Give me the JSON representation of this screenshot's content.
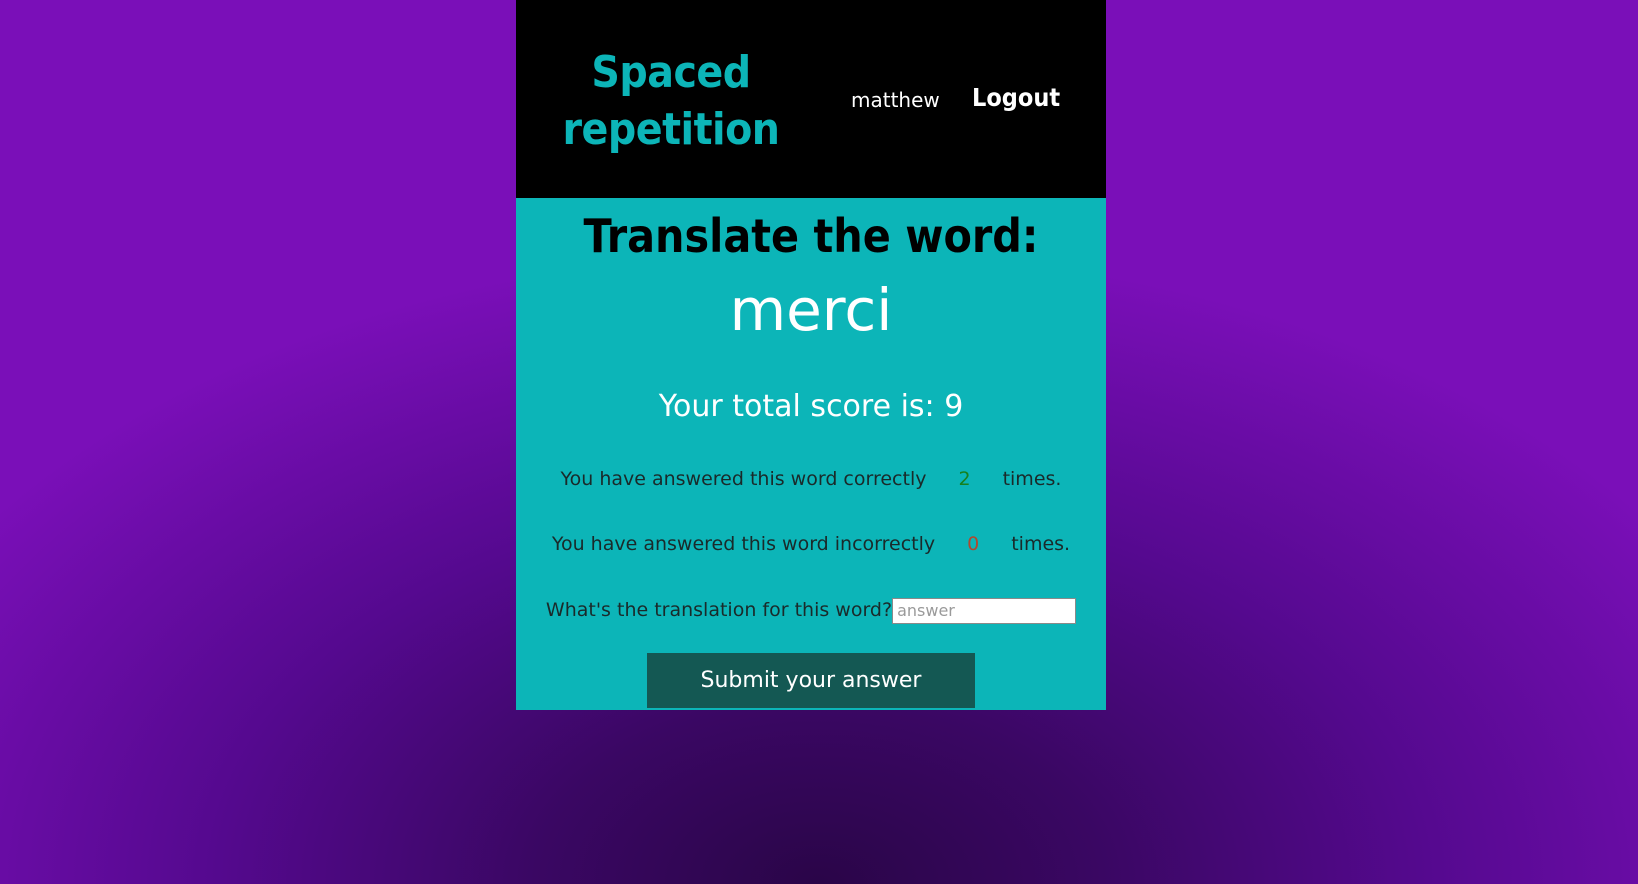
{
  "header": {
    "logo_line1": "Spaced",
    "logo_line2": "repetition",
    "username": "matthew",
    "logout_label": "Logout"
  },
  "learning": {
    "heading": "Translate the word:",
    "word": "merci",
    "score_text": "Your total score is: 9",
    "correct_prefix": "You have answered this word correctly",
    "correct_count": "2",
    "correct_suffix": "times.",
    "incorrect_prefix": "You have answered this word incorrectly",
    "incorrect_count": "0",
    "incorrect_suffix": "times.",
    "answer_label": "What's the translation for this word?",
    "answer_placeholder": "answer",
    "answer_value": "",
    "submit_label": "Submit your answer"
  },
  "colors": {
    "accent": "#0cb5b8",
    "header_bg": "#000000",
    "button_bg": "#145853",
    "correct_count": "#17801f",
    "incorrect_count": "#b0492f",
    "page_bg": "#7a0fb8"
  }
}
